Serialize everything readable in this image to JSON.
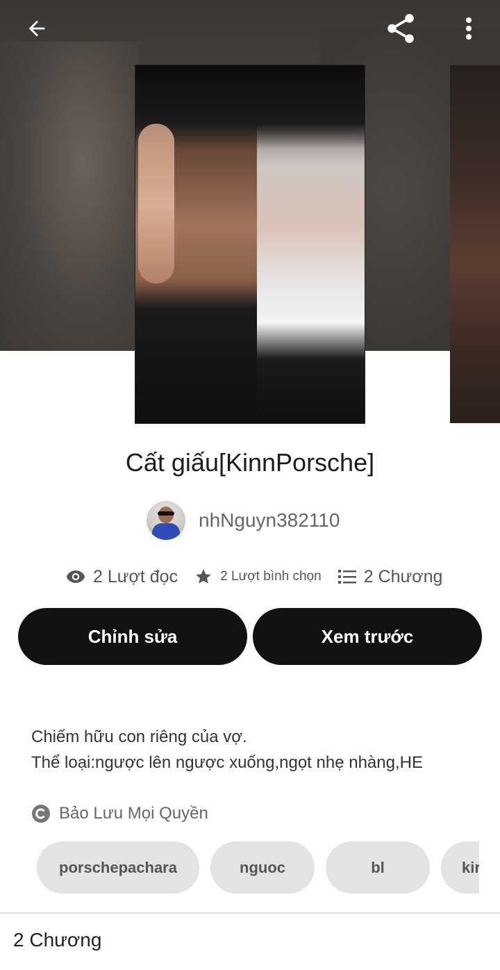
{
  "header": {
    "back_icon": "arrow-left-icon",
    "share_icon": "share-icon",
    "menu_icon": "more-vertical-icon"
  },
  "story": {
    "title": "Cất giấu[KinnPorsche]",
    "author": "nhNguyn382110",
    "stats": {
      "reads": "2 Lượt đọc",
      "votes": "2 Lượt bình chọn",
      "chapters": "2 Chương"
    },
    "description_lines": [
      "Chiếm hữu con riêng của vợ.",
      "Thể loại:ngược lên ngược xuống,ngọt nhẹ nhàng,HE"
    ],
    "copyright": "Bảo Lưu Mọi Quyền",
    "tags": [
      "porschepachara",
      "nguoc",
      "bl",
      "kir"
    ]
  },
  "actions": {
    "edit_label": "Chỉnh sửa",
    "preview_label": "Xem trước"
  },
  "chapters_section": {
    "heading": "2 Chương"
  },
  "colors": {
    "button_bg": "#121212",
    "tag_bg": "#e3e3e3",
    "hero_bg": "#46413e"
  }
}
